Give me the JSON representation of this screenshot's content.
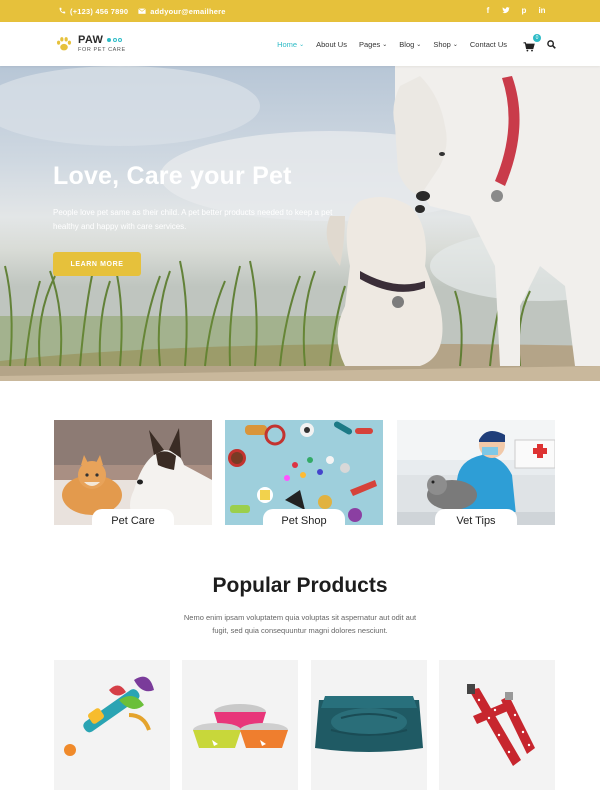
{
  "topbar": {
    "phone": "(+123) 456 7890",
    "email": "addyour@emailhere",
    "socials": [
      "facebook-icon",
      "twitter-icon",
      "pinterest-icon",
      "linkedin-icon"
    ]
  },
  "header": {
    "logo_name": "PAW",
    "logo_tagline": "FOR PET CARE",
    "nav": [
      {
        "label": "Home",
        "dropdown": true,
        "active": true
      },
      {
        "label": "About Us",
        "dropdown": false
      },
      {
        "label": "Pages",
        "dropdown": true
      },
      {
        "label": "Blog",
        "dropdown": true
      },
      {
        "label": "Shop",
        "dropdown": true
      },
      {
        "label": "Contact Us",
        "dropdown": false
      }
    ],
    "cart_count": "0"
  },
  "hero": {
    "title": "Love, Care your Pet",
    "text": "People love pet same as their child. A pet better products needed to keep a pet healthy and happy with care services.",
    "button": "LEARN MORE"
  },
  "categories": [
    {
      "label": "Pet Care"
    },
    {
      "label": "Pet Shop"
    },
    {
      "label": "Vet Tips"
    }
  ],
  "popular": {
    "title": "Popular Products",
    "subtitle": "Nemo enim ipsam voluptatem quia voluptas sit aspernatur aut odit aut fugit, sed quia consequuntur magni dolores nesciunt."
  },
  "colors": {
    "accent_yellow": "#e6c13b",
    "accent_teal": "#2dbbc6"
  }
}
